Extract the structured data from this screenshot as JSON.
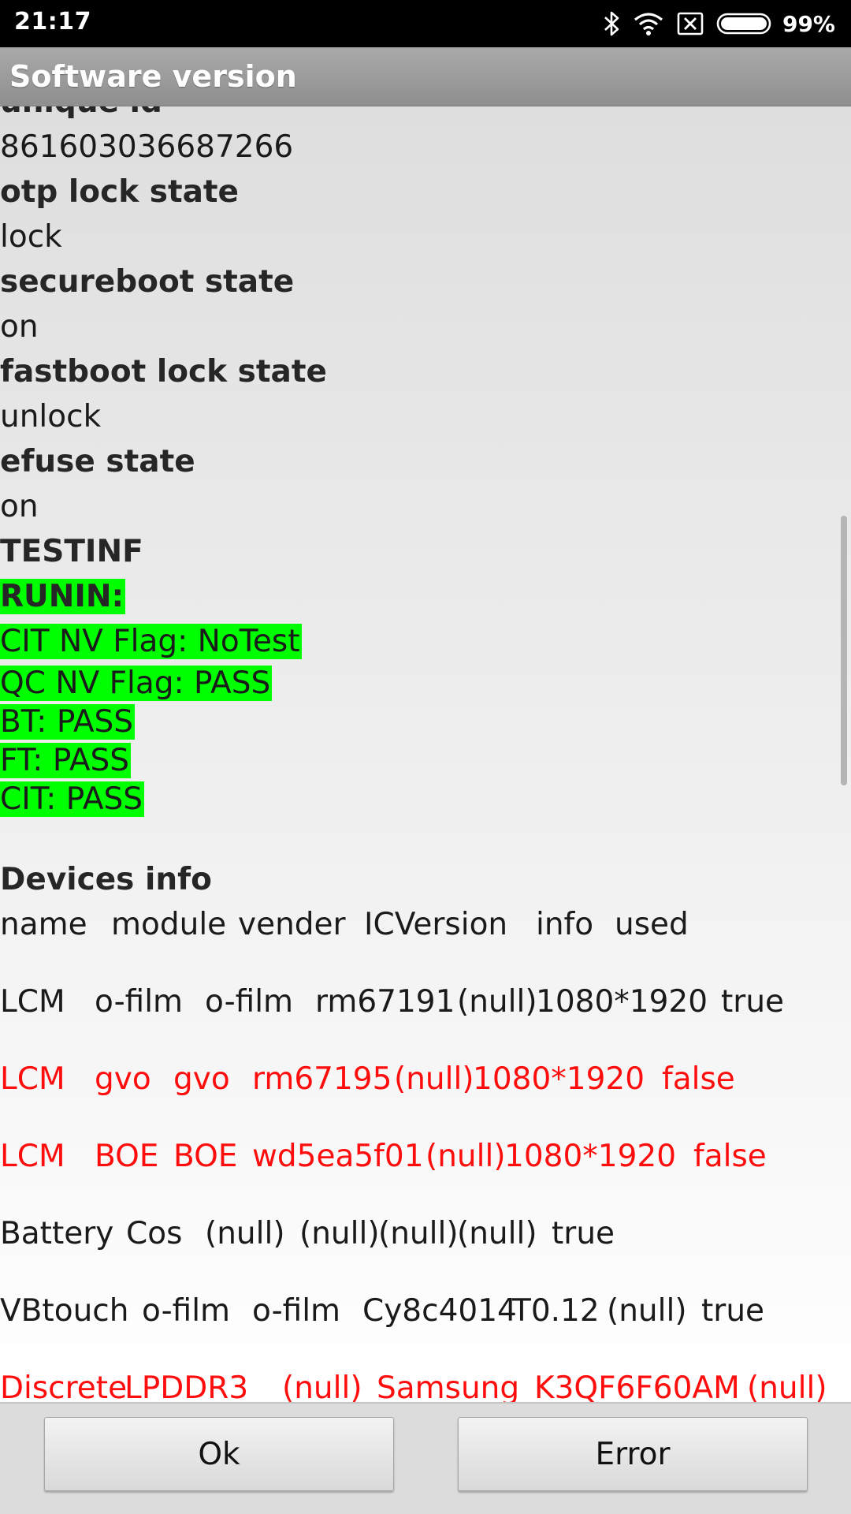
{
  "status_bar": {
    "time": "21:17",
    "battery_percent": "99%",
    "icons": [
      "bluetooth-icon",
      "wifi-icon",
      "no-sim-icon",
      "battery-icon"
    ]
  },
  "title": "Software version",
  "info": {
    "partial_label": "unique id",
    "unique_id_value": "861603036687266",
    "otp_label": "otp lock state",
    "otp_value": "lock",
    "secureboot_label": "secureboot state",
    "secureboot_value": "on",
    "fastboot_label": "fastboot lock state",
    "fastboot_value": "unlock",
    "efuse_label": "efuse state",
    "efuse_value": "on",
    "testinf_label": "TESTINF"
  },
  "runin": {
    "label": "RUNIN:",
    "lines": [
      "CIT NV Flag:  NoTest",
      "QC NV Flag:  PASS",
      "BT: PASS",
      "FT: PASS",
      "CIT: PASS"
    ],
    "highlight_color": "#00ff00"
  },
  "devices": {
    "title": "Devices info",
    "header": [
      "name",
      "module",
      "vender",
      "ICVersion",
      "info",
      "used"
    ],
    "rows": [
      {
        "cells": [
          "LCM",
          "o-film",
          "o-film",
          "rm67191",
          "(null)",
          "1080*1920",
          "true"
        ],
        "color": "#1a1a1a"
      },
      {
        "cells": [
          "LCM",
          "gvo",
          "gvo",
          "rm67195",
          "(null)",
          "1080*1920",
          "false"
        ],
        "color": "#ff0d0d"
      },
      {
        "cells": [
          "LCM",
          "BOE",
          "BOE",
          "wd5ea5f01",
          "(null)",
          "1080*1920",
          "false"
        ],
        "color": "#ff0d0d"
      },
      {
        "cells": [
          "Battery",
          "Cos",
          "(null)",
          "(null)",
          "(null)",
          "(null)",
          "true"
        ],
        "color": "#1a1a1a"
      },
      {
        "cells": [
          "VBtouch",
          "o-film",
          "o-film",
          "Cy8c4014",
          "T0.12",
          "(null)",
          "true"
        ],
        "color": "#1a1a1a"
      },
      {
        "cells": [
          "Discrete",
          "LPDDR3",
          "(null)",
          "Samsung",
          "K3QF6F60AM",
          "(null)"
        ],
        "color": "#ff0d0d"
      }
    ]
  },
  "buttons": {
    "ok": "Ok",
    "error": "Error"
  }
}
